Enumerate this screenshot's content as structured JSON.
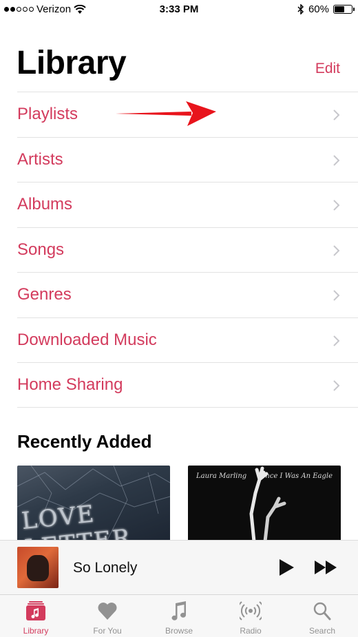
{
  "status_bar": {
    "carrier": "Verizon",
    "time": "3:33 PM",
    "battery": "60%",
    "battery_level": 0.6
  },
  "header": {
    "title": "Library",
    "edit_label": "Edit"
  },
  "library_items": [
    {
      "label": "Playlists"
    },
    {
      "label": "Artists"
    },
    {
      "label": "Albums"
    },
    {
      "label": "Songs"
    },
    {
      "label": "Genres"
    },
    {
      "label": "Downloaded Music"
    },
    {
      "label": "Home Sharing"
    }
  ],
  "recently_added": {
    "title": "Recently Added",
    "albums": [
      {
        "cover_text": "LOVE LETTER"
      },
      {
        "artist": "Laura Marling",
        "title": "Once I Was An Eagle"
      }
    ]
  },
  "mini_player": {
    "track_title": "So Lonely"
  },
  "tab_bar": {
    "tabs": [
      {
        "label": "Library",
        "icon": "library-icon",
        "active": true
      },
      {
        "label": "For You",
        "icon": "heart-icon",
        "active": false
      },
      {
        "label": "Browse",
        "icon": "music-note-icon",
        "active": false
      },
      {
        "label": "Radio",
        "icon": "radio-icon",
        "active": false
      },
      {
        "label": "Search",
        "icon": "search-icon",
        "active": false
      }
    ]
  },
  "colors": {
    "accent": "#d33b5d",
    "annotation_arrow": "#e8141c",
    "separator": "#e2e2e2",
    "inactive_tab": "#929292"
  }
}
